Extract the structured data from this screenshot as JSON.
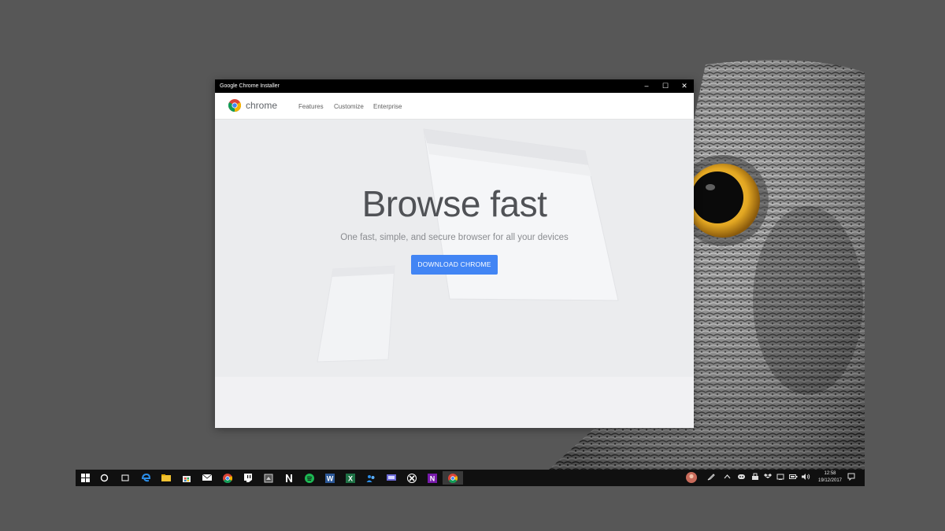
{
  "window": {
    "title": "Google Chrome Installer",
    "minimize_glyph": "–",
    "maximize_glyph": "☐",
    "close_glyph": "✕"
  },
  "header": {
    "brand": "chrome",
    "nav": [
      "Features",
      "Customize",
      "Enterprise"
    ]
  },
  "hero": {
    "headline": "Browse fast",
    "subline": "One fast, simple, and secure browser for all your devices",
    "cta": "DOWNLOAD CHROME"
  },
  "taskbar": {
    "icons": [
      "windows-start-icon",
      "cortana-icon",
      "task-view-icon",
      "edge-icon",
      "file-explorer-icon",
      "store-icon",
      "mail-icon",
      "chrome-icon",
      "twitch-icon",
      "screenshot-icon",
      "notion-icon",
      "spotify-icon",
      "word-icon",
      "excel-icon",
      "people-icon",
      "monitor-app-icon",
      "xbox-icon",
      "onenote-icon",
      "chrome-installer-icon"
    ],
    "clock_time": "12:58",
    "clock_date": "19/12/2017"
  },
  "colors": {
    "accent": "#4285f4",
    "titlebar": "#000000",
    "desktop": "#575757"
  }
}
